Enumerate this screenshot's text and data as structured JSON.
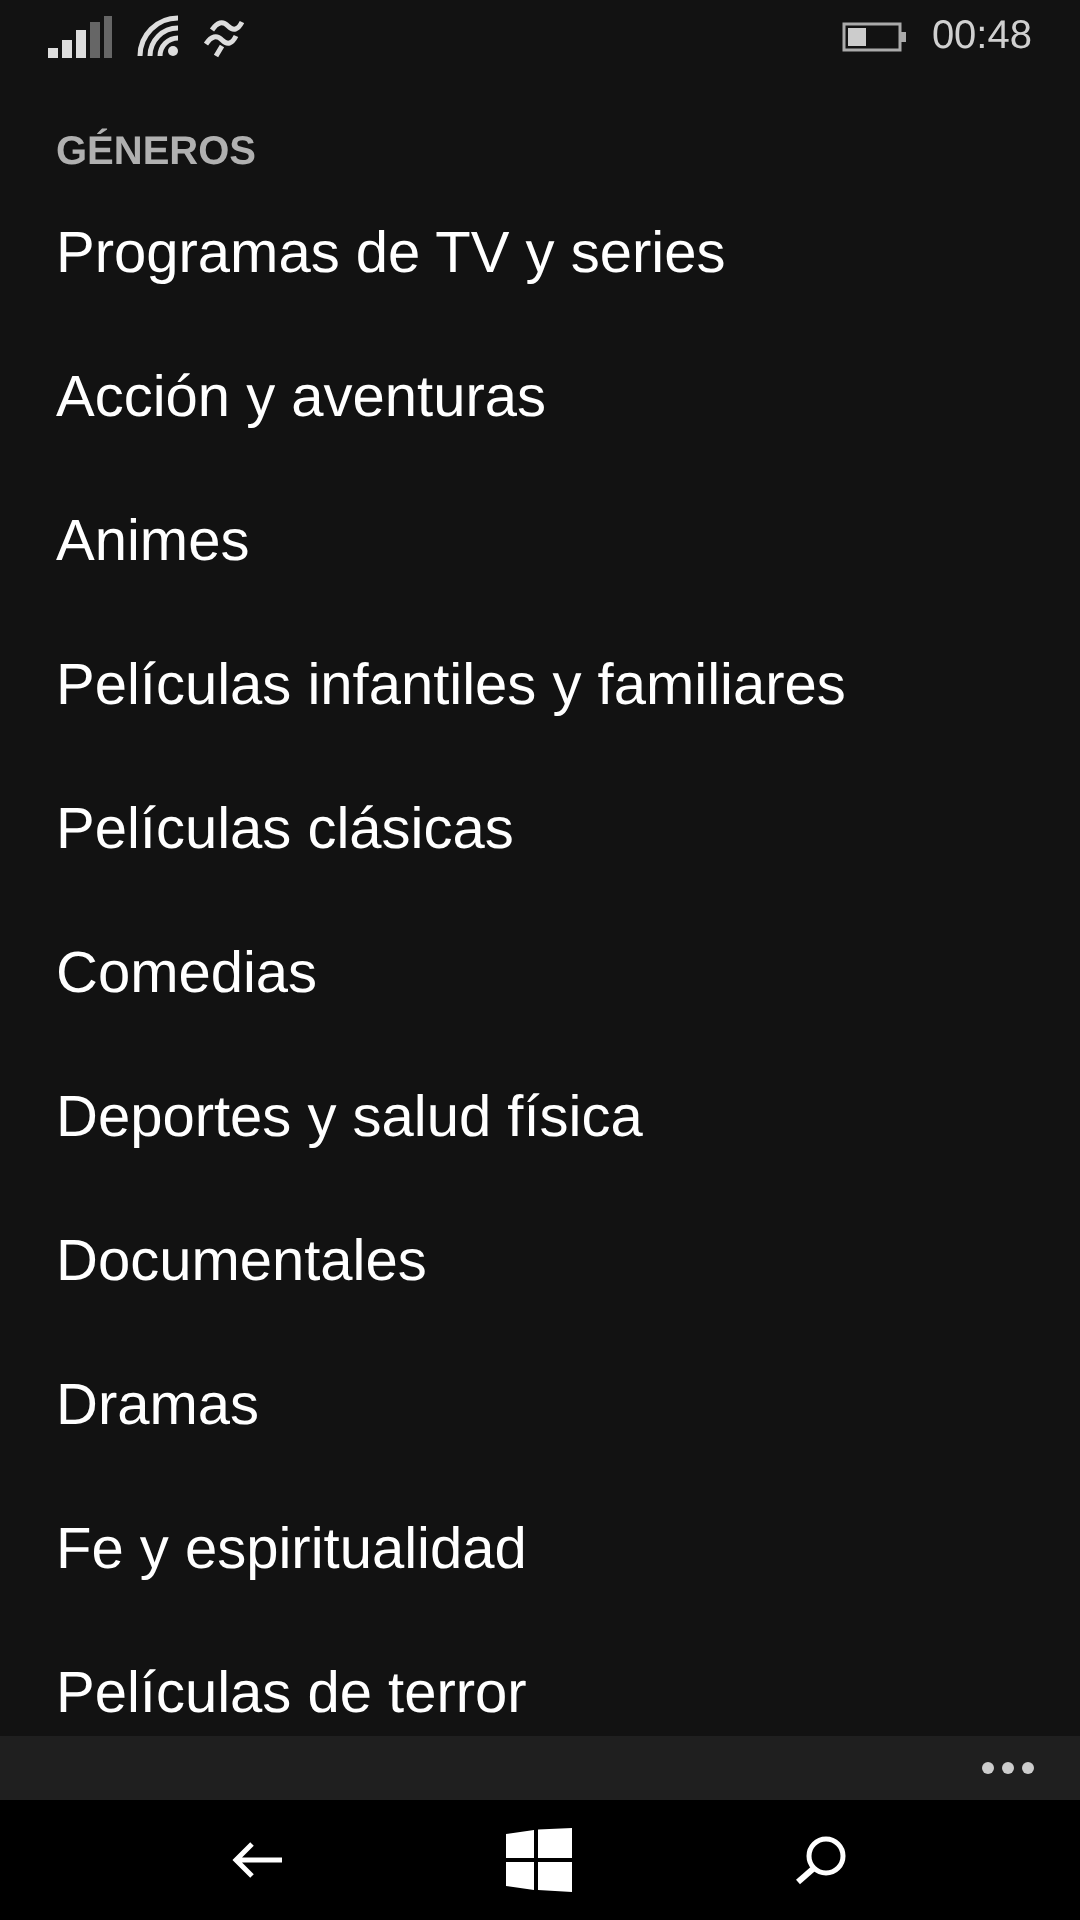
{
  "status_bar": {
    "time": "00:48"
  },
  "section_title": "GÉNEROS",
  "genres": [
    {
      "label": "Programas de TV y series"
    },
    {
      "label": "Acción y aventuras"
    },
    {
      "label": "Animes"
    },
    {
      "label": "Películas infantiles y familiares"
    },
    {
      "label": "Películas clásicas"
    },
    {
      "label": "Comedias"
    },
    {
      "label": "Deportes y salud física"
    },
    {
      "label": "Documentales"
    },
    {
      "label": "Dramas"
    },
    {
      "label": "Fe y espiritualidad"
    },
    {
      "label": "Películas de terror"
    }
  ]
}
